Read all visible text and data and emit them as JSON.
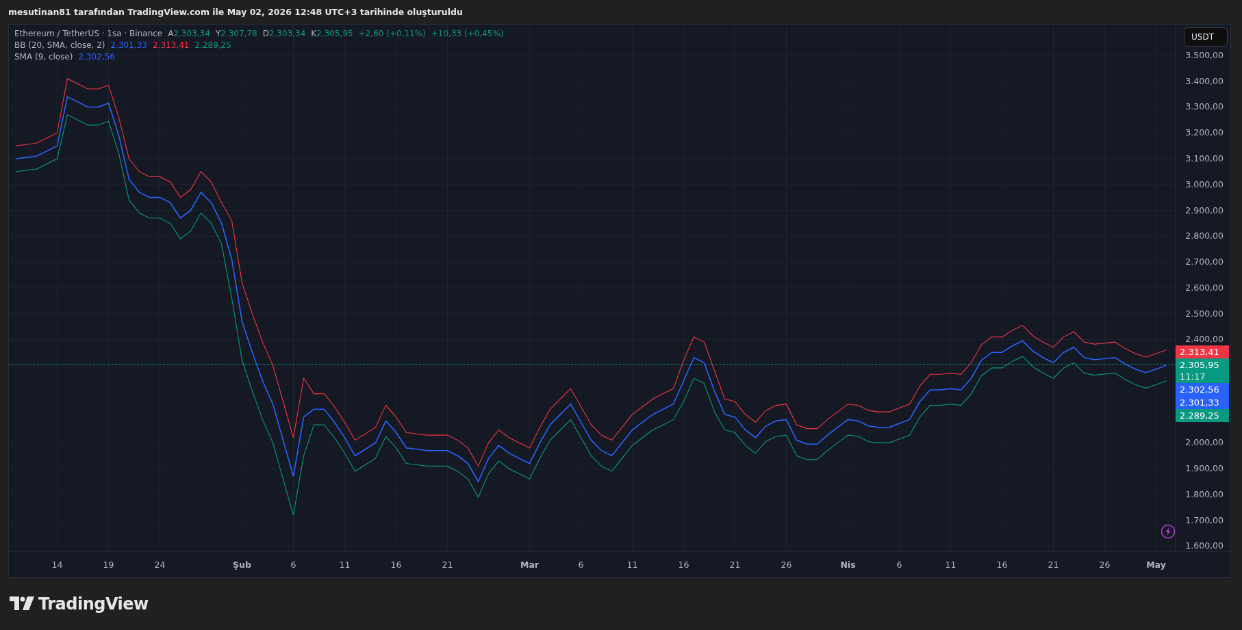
{
  "title_bar": {
    "text": "mesutinan81 tarafından TradingView.com ile May 02, 2026 12:48 UTC+3 tarihinde oluşturuldu"
  },
  "legend": {
    "symbol": "Ethereum / TetherUS · 1sa · Binance",
    "ohlc": [
      {
        "label": "A",
        "value": "2.303,34"
      },
      {
        "label": "Y",
        "value": "2.307,78"
      },
      {
        "label": "D",
        "value": "2.303,34"
      },
      {
        "label": "K",
        "value": "2.305,95"
      }
    ],
    "changes": [
      "+2,60 (+0,11%)",
      "+10,33 (+0,45%)"
    ],
    "indicators": [
      {
        "name": "BB (20, SMA, close, 2)",
        "values": [
          {
            "text": "2.301,33",
            "color": "#2962ff"
          },
          {
            "text": "2.313,41",
            "color": "#f23645"
          },
          {
            "text": "2.289,25",
            "color": "#089981"
          }
        ]
      },
      {
        "name": "SMA (9, close)",
        "values": [
          {
            "text": "2.302,56",
            "color": "#2962ff"
          }
        ]
      }
    ]
  },
  "currency_button": "USDT",
  "axis_tags": [
    {
      "text": "2.313,41",
      "color": "#f23645"
    },
    {
      "text": "2.305,95",
      "countdown": "11:17",
      "color": "#089981"
    },
    {
      "text": "2.302,56",
      "color": "#2962ff"
    },
    {
      "text": "2.301,33",
      "color": "#2962ff"
    },
    {
      "text": "2.289,25",
      "color": "#089981"
    }
  ],
  "chart_data": {
    "type": "line",
    "categories": [
      null,
      null,
      null,
      null,
      "14",
      null,
      null,
      null,
      null,
      "19",
      null,
      null,
      null,
      null,
      "24",
      null,
      null,
      null,
      null,
      null,
      null,
      null,
      "Şub",
      null,
      null,
      null,
      null,
      "6",
      null,
      null,
      null,
      null,
      "11",
      null,
      null,
      null,
      null,
      "16",
      null,
      null,
      null,
      null,
      "21",
      null,
      null,
      null,
      null,
      null,
      null,
      null,
      "Mar",
      null,
      null,
      null,
      null,
      "6",
      null,
      null,
      null,
      null,
      "11",
      null,
      null,
      null,
      null,
      "16",
      null,
      null,
      null,
      null,
      "21",
      null,
      null,
      null,
      null,
      "26",
      null,
      null,
      null,
      null,
      null,
      "Nis",
      null,
      null,
      null,
      null,
      "6",
      null,
      null,
      null,
      null,
      "11",
      null,
      null,
      null,
      null,
      "16",
      null,
      null,
      null,
      null,
      "21",
      null,
      null,
      null,
      null,
      "26",
      null,
      null,
      null,
      null,
      "May",
      null
    ],
    "series": [
      {
        "color": "#f23645",
        "values": [
          3150,
          3155,
          3160,
          3180,
          3200,
          3410,
          3390,
          3370,
          3370,
          3385,
          3260,
          3100,
          3050,
          3030,
          3030,
          3010,
          2950,
          2980,
          3050,
          3010,
          2930,
          2860,
          2620,
          2500,
          2390,
          2300,
          2160,
          2020,
          2250,
          2190,
          2190,
          2140,
          2080,
          2010,
          2035,
          2060,
          2145,
          2100,
          2040,
          2035,
          2030,
          2030,
          2030,
          2010,
          1980,
          1910,
          2000,
          2050,
          2020,
          2000,
          1980,
          2060,
          2130,
          2170,
          2210,
          2140,
          2070,
          2030,
          2010,
          2060,
          2110,
          2140,
          2170,
          2190,
          2210,
          2320,
          2410,
          2390,
          2280,
          2170,
          2160,
          2110,
          2080,
          2125,
          2145,
          2150,
          2070,
          2055,
          2055,
          2090,
          2120,
          2150,
          2145,
          2125,
          2120,
          2120,
          2135,
          2150,
          2220,
          2265,
          2265,
          2270,
          2265,
          2310,
          2380,
          2410,
          2410,
          2435,
          2455,
          2415,
          2390,
          2370,
          2410,
          2430,
          2390,
          2382,
          2386,
          2390,
          2365,
          2345,
          2332,
          2345,
          2360
        ]
      },
      {
        "color": "#089981",
        "values": [
          3050,
          3055,
          3060,
          3080,
          3100,
          3270,
          3250,
          3230,
          3230,
          3245,
          3120,
          2940,
          2890,
          2870,
          2870,
          2850,
          2790,
          2820,
          2890,
          2850,
          2770,
          2560,
          2320,
          2200,
          2090,
          2000,
          1860,
          1720,
          1950,
          2070,
          2070,
          2020,
          1960,
          1890,
          1915,
          1940,
          2025,
          1980,
          1920,
          1915,
          1910,
          1910,
          1910,
          1890,
          1860,
          1790,
          1880,
          1930,
          1900,
          1880,
          1860,
          1940,
          2010,
          2050,
          2090,
          2020,
          1950,
          1910,
          1890,
          1940,
          1990,
          2020,
          2050,
          2070,
          2090,
          2160,
          2250,
          2230,
          2120,
          2050,
          2040,
          1990,
          1960,
          2005,
          2025,
          2030,
          1950,
          1935,
          1935,
          1970,
          2000,
          2030,
          2025,
          2005,
          2000,
          2000,
          2015,
          2030,
          2100,
          2145,
          2145,
          2150,
          2145,
          2190,
          2260,
          2290,
          2290,
          2315,
          2335,
          2295,
          2270,
          2250,
          2290,
          2310,
          2270,
          2262,
          2266,
          2270,
          2245,
          2225,
          2212,
          2225,
          2240
        ]
      },
      {
        "color": "#2962ff",
        "values": [
          3100,
          3105,
          3110,
          3130,
          3150,
          3340,
          3320,
          3300,
          3300,
          3315,
          3190,
          3020,
          2970,
          2950,
          2950,
          2930,
          2870,
          2900,
          2970,
          2930,
          2850,
          2710,
          2470,
          2350,
          2240,
          2150,
          2010,
          1870,
          2100,
          2130,
          2130,
          2080,
          2020,
          1950,
          1975,
          2000,
          2085,
          2040,
          1980,
          1975,
          1970,
          1970,
          1970,
          1950,
          1920,
          1850,
          1940,
          1990,
          1960,
          1940,
          1920,
          2000,
          2070,
          2110,
          2150,
          2080,
          2010,
          1970,
          1950,
          2000,
          2050,
          2080,
          2110,
          2130,
          2150,
          2240,
          2330,
          2310,
          2200,
          2110,
          2100,
          2050,
          2020,
          2065,
          2085,
          2090,
          2010,
          1995,
          1995,
          2030,
          2060,
          2090,
          2085,
          2065,
          2060,
          2060,
          2075,
          2090,
          2160,
          2205,
          2205,
          2210,
          2205,
          2250,
          2320,
          2350,
          2350,
          2375,
          2395,
          2355,
          2330,
          2310,
          2350,
          2370,
          2330,
          2322,
          2326,
          2330,
          2305,
          2285,
          2272,
          2285,
          2300
        ]
      }
    ],
    "ylim": [
      1580,
      3619
    ],
    "yticks": [
      {
        "value": 1600,
        "label": "1.600,00"
      },
      {
        "value": 1700,
        "label": "1.700,00"
      },
      {
        "value": 1800,
        "label": "1.800,00"
      },
      {
        "value": 1900,
        "label": "1.900,00"
      },
      {
        "value": 2000,
        "label": "2.000,00"
      },
      {
        "value": 2400,
        "label": "2.400,00"
      },
      {
        "value": 2500,
        "label": "2.500,00"
      },
      {
        "value": 2600,
        "label": "2.600,00"
      },
      {
        "value": 2700,
        "label": "2.700,00"
      },
      {
        "value": 2800,
        "label": "2.800,00"
      },
      {
        "value": 2900,
        "label": "2.900,00"
      },
      {
        "value": 3000,
        "label": "3.000,00"
      },
      {
        "value": 3100,
        "label": "3.100,00"
      },
      {
        "value": 3200,
        "label": "3.200,00"
      },
      {
        "value": 3300,
        "label": "3.300,00"
      },
      {
        "value": 3400,
        "label": "3.400,00"
      },
      {
        "value": 3500,
        "label": "3.500,00"
      }
    ],
    "grid": true
  },
  "footer": {
    "brand": "TradingView"
  }
}
